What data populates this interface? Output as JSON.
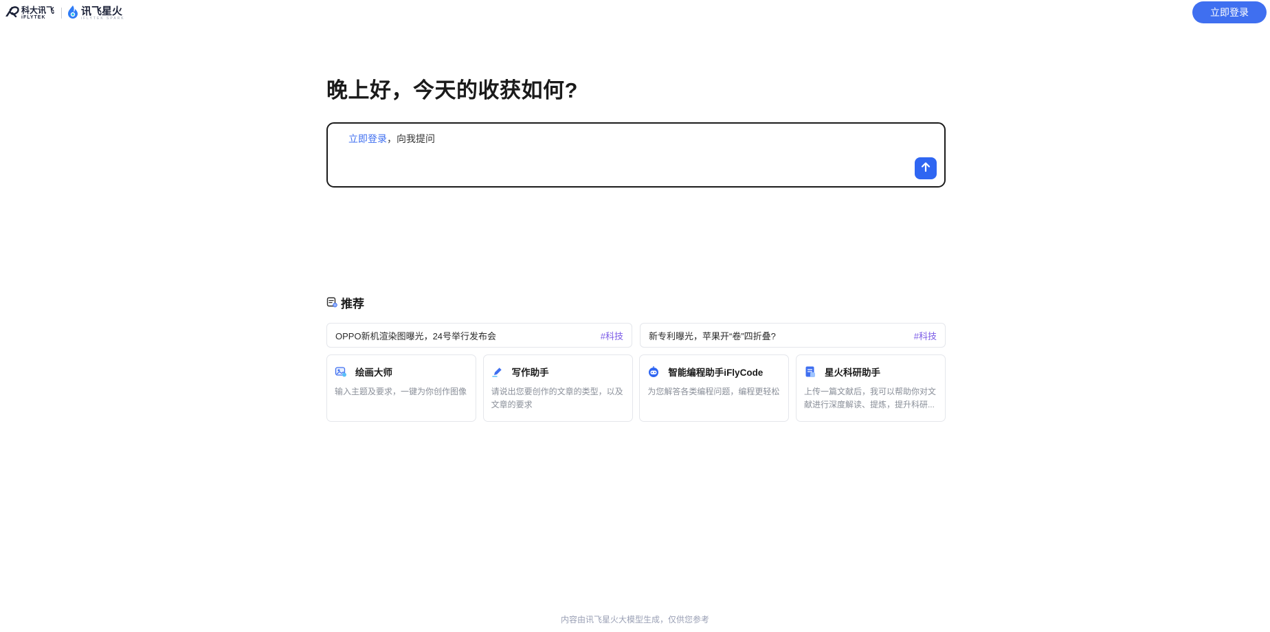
{
  "header": {
    "logo_iflytek_cn": "科大讯飞",
    "logo_iflytek_en": "iFLYTEK",
    "logo_spark_cn": "讯飞星火",
    "logo_spark_en": "iFLYTEK SPARK",
    "login_button": "立即登录"
  },
  "main": {
    "greeting": "晚上好，今天的收获如何?",
    "input": {
      "login_link": "立即登录",
      "prompt_suffix": "，向我提问"
    }
  },
  "recommend": {
    "title": "推荐",
    "news": [
      {
        "text": "OPPO新机渲染图曝光，24号举行发布会",
        "tag": "#科技"
      },
      {
        "text": "新专利曝光，苹果开“卷”四折叠?",
        "tag": "#科技"
      }
    ],
    "tools": [
      {
        "name": "绘画大师",
        "icon": "paint-icon",
        "desc": "输入主题及要求，一键为你创作图像"
      },
      {
        "name": "写作助手",
        "icon": "pen-icon",
        "desc": "请说出您要创作的文章的类型，以及文章的要求"
      },
      {
        "name": "智能编程助手iFlyCode",
        "icon": "robot-icon",
        "desc": "为您解答各类编程问题，编程更轻松"
      },
      {
        "name": "星火科研助手",
        "icon": "document-icon",
        "desc": "上传一篇文献后，我可以帮助你对文献进行深度解读、提炼，提升科研..."
      }
    ]
  },
  "footer": {
    "disclaimer": "内容由讯飞星火大模型生成，仅供您参考"
  },
  "colors": {
    "accent": "#3f6ff0",
    "tag": "#7a5ae6"
  }
}
